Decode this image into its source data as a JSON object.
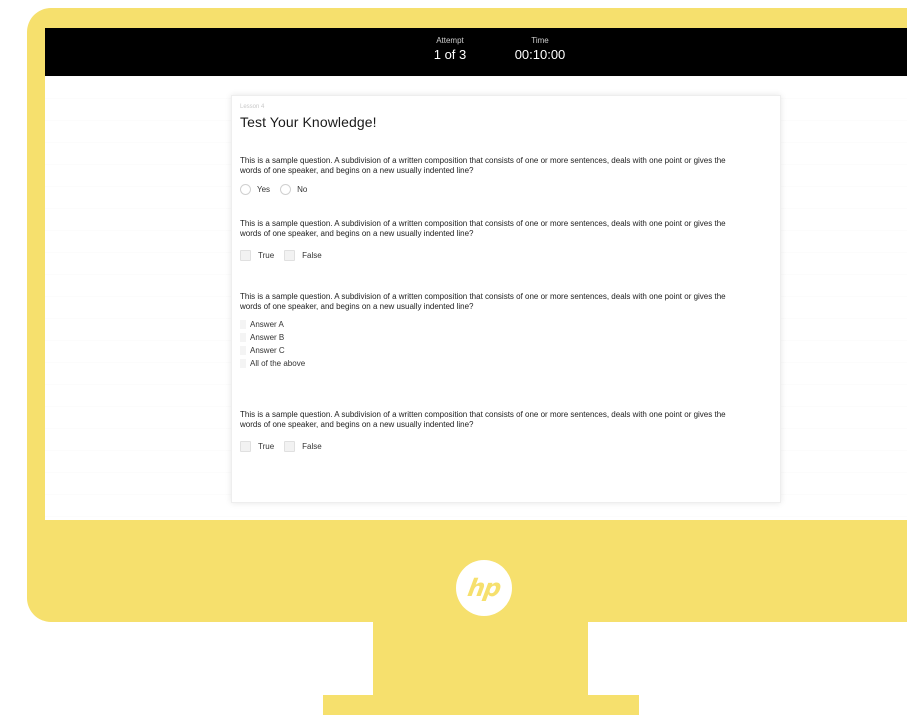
{
  "colors": {
    "bezel": "#f6e06d",
    "topbar": "#000000",
    "card": "#ffffff"
  },
  "brand": {
    "logo_text": "hp"
  },
  "topbar": {
    "attempt_label": "Attempt",
    "attempt_value": "1 of 3",
    "time_label": "Time",
    "time_value": "00:10:00"
  },
  "quiz": {
    "lesson_label": "Lesson 4",
    "title": "Test Your Knowledge!",
    "questions": [
      {
        "text": "This is a sample question. A subdivision of a written composition that consists of one or more sentences, deals with one point or gives the words of one speaker, and begins on a new usually indented line?",
        "options": [
          "Yes",
          "No"
        ]
      },
      {
        "text": "This is a sample question. A subdivision of a written composition that consists of one or more sentences, deals with one point or gives the words of one speaker, and begins on a new usually indented line?",
        "options": [
          "True",
          "False"
        ]
      },
      {
        "text": "This is a sample question. A subdivision of a written composition that consists of one or more sentences, deals with one point or gives the words of one speaker, and begins on a new usually indented line?",
        "options": [
          "Answer A",
          "Answer B",
          "Answer C",
          "All of the above"
        ]
      },
      {
        "text": "This is a sample question. A subdivision of a written composition that consists of one or more sentences, deals with one point or gives the words of one speaker, and begins on a new usually indented line?",
        "options": [
          "True",
          "False"
        ]
      }
    ]
  }
}
